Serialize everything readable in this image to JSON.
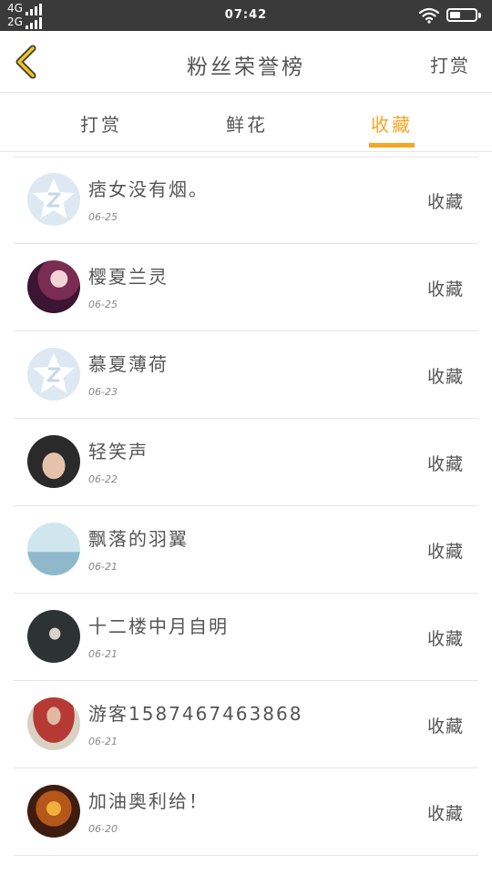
{
  "status": {
    "net_top": "4G",
    "net_bottom": "2G",
    "time": "07:42"
  },
  "header": {
    "title": "粉丝荣誉榜",
    "right_link": "打赏"
  },
  "tabs": [
    {
      "label": "打赏",
      "active": false
    },
    {
      "label": "鲜花",
      "active": false
    },
    {
      "label": "收藏",
      "active": true
    }
  ],
  "accent_color": "#f5a623",
  "list": [
    {
      "name": "痞女没有烟。",
      "date": "06-25",
      "action": "收藏",
      "avatar": "default-avatar"
    },
    {
      "name": "樱夏兰灵",
      "date": "06-25",
      "action": "收藏",
      "avatar": "anime-girl-avatar"
    },
    {
      "name": "慕夏薄荷",
      "date": "06-23",
      "action": "收藏",
      "avatar": "default-avatar"
    },
    {
      "name": "轻笑声",
      "date": "06-22",
      "action": "收藏",
      "avatar": "portrait-avatar"
    },
    {
      "name": "飘落的羽翼",
      "date": "06-21",
      "action": "收藏",
      "avatar": "car-avatar"
    },
    {
      "name": "十二楼中月自明",
      "date": "06-21",
      "action": "收藏",
      "avatar": "dark-figure-avatar"
    },
    {
      "name": "游客15874674638​68",
      "date": "06-21",
      "action": "收藏",
      "avatar": "photo-avatar"
    },
    {
      "name": "加油奥利给！",
      "date": "06-20",
      "action": "收藏",
      "avatar": "fire-avatar"
    }
  ]
}
